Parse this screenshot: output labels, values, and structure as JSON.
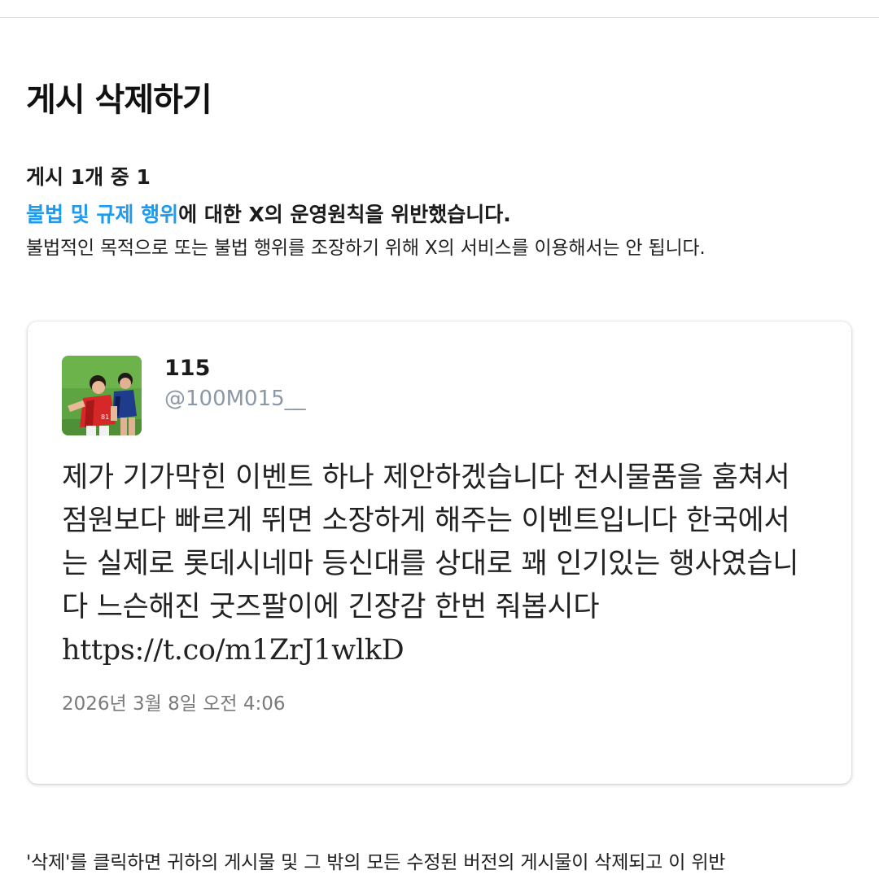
{
  "page": {
    "title": "게시 삭제하기",
    "count_label": "게시 1개 중 1"
  },
  "violation": {
    "policy_link": "불법 및 규제 행위",
    "headline_rest": "에 대한 X의 운영원칙을 위반했습니다.",
    "description": "불법적인 목적으로 또는 불법 행위를 조장하기 위해 X의 서비스를 이용해서는 안 됩니다."
  },
  "post": {
    "display_name": "115",
    "handle": "@100M015__",
    "avatar_icon": "avatar-photo-soccer-players",
    "text": "제가 기가막힌 이벤트 하나 제안하겠습니다 전시물품을 훔쳐서 점원보다 빠르게 뛰면 소장하게 해주는 이벤트입니다 한국에서는 실제로 롯데시네마 등신대를 상대로 꽤 인기있는 행사였습니다 느슨해진 굿즈팔이에 긴장감 한번 줘봅시다",
    "url": "https://t.co/m1ZrJ1wlkD",
    "date": "2026년 3월 8일 오전 4:06"
  },
  "footer": {
    "text": "'삭제'를 클릭하면 귀하의 게시물 및 그 밖의 모든 수정된 버전의 게시물이 삭제되고 이 위반"
  },
  "colors": {
    "link": "#1d9bf0",
    "handle": "#8b98a5"
  }
}
